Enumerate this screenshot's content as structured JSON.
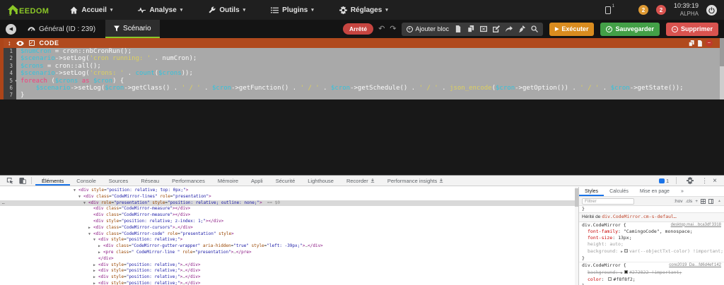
{
  "icons": {
    "caret": "▾",
    "play": "▶",
    "check": "✓",
    "minus": "–",
    "plus": "+",
    "undo": "↶",
    "redo": "↷",
    "back": "◀",
    "dots": "⋮",
    "close": "×",
    "up_arrow": "▲",
    "more": "»",
    "drag": "↕"
  },
  "topnav": {
    "brand_text": "EEDOM",
    "caret": "▾",
    "items": [
      {
        "label": "Accueil",
        "icon": "home-icon"
      },
      {
        "label": "Analyse",
        "icon": "pulse-icon"
      },
      {
        "label": "Outils",
        "icon": "wrench-icon"
      },
      {
        "label": "Plugins",
        "icon": "list-icon"
      },
      {
        "label": "Réglages",
        "icon": "gear-icon"
      }
    ],
    "mobile_indicator": "1",
    "warning_count": "2",
    "error_count": "2",
    "time": "10:39:19",
    "version": "ALPHA"
  },
  "subnav": {
    "general_tab": "Général (ID : 239)",
    "scenario_tab": "Scénario",
    "status_badge": "Arrêté",
    "add_block_label": "Ajouter bloc",
    "execute_label": "Exécuter",
    "save_label": "Sauvegarder",
    "delete_label": "Supprimer"
  },
  "code_block": {
    "title": "CODE",
    "fold_marker": "▾",
    "lines": [
      {
        "num": "1",
        "tokens": [
          [
            "v",
            "$numCron"
          ],
          [
            "p",
            " = cron::nbCronRun();"
          ]
        ]
      },
      {
        "num": "2",
        "tokens": [
          [
            "v",
            "$scenario"
          ],
          [
            "p",
            "->setLog("
          ],
          [
            "s",
            "'cron running: '"
          ],
          [
            "p",
            " . numCron);"
          ]
        ]
      },
      {
        "num": "3",
        "tokens": [
          [
            "v",
            "$crons"
          ],
          [
            "p",
            " = cron::all();"
          ]
        ]
      },
      {
        "num": "4",
        "tokens": [
          [
            "v",
            "$scenario"
          ],
          [
            "p",
            "->setLog("
          ],
          [
            "s",
            "'crons: '"
          ],
          [
            "p",
            " . "
          ],
          [
            "v",
            "count"
          ],
          [
            "p",
            "("
          ],
          [
            "v",
            "$crons"
          ],
          [
            "p",
            "));"
          ]
        ]
      },
      {
        "num": "5",
        "fold": true,
        "tokens": [
          [
            "k",
            "foreach"
          ],
          [
            "p",
            " ("
          ],
          [
            "v",
            "$crons"
          ],
          [
            "p",
            " "
          ],
          [
            "k",
            "as"
          ],
          [
            "p",
            " "
          ],
          [
            "v",
            "$cron"
          ],
          [
            "p",
            ") {"
          ]
        ]
      },
      {
        "num": "6",
        "tokens": [
          [
            "p",
            "    "
          ],
          [
            "v",
            "$scenario"
          ],
          [
            "p",
            "->setLog("
          ],
          [
            "v",
            "$cron"
          ],
          [
            "p",
            "->getClass() . "
          ],
          [
            "s",
            "' / '"
          ],
          [
            "p",
            " . "
          ],
          [
            "v",
            "$cron"
          ],
          [
            "p",
            "->getFunction() . "
          ],
          [
            "s",
            "' / '"
          ],
          [
            "p",
            " . "
          ],
          [
            "v",
            "$cron"
          ],
          [
            "p",
            "->getSchedule() . "
          ],
          [
            "s",
            "' / '"
          ],
          [
            "p",
            " . "
          ],
          [
            "s",
            "json_encode"
          ],
          [
            "p",
            "("
          ],
          [
            "v",
            "$cron"
          ],
          [
            "p",
            "->getOption()) . "
          ],
          [
            "s",
            "' / '"
          ],
          [
            "p",
            " . "
          ],
          [
            "v",
            "$cron"
          ],
          [
            "p",
            "->getState());"
          ]
        ]
      },
      {
        "num": "7",
        "tokens": [
          [
            "p",
            "}"
          ]
        ]
      }
    ]
  },
  "devtools": {
    "arrows": {
      "v": "▼",
      "r": "▶"
    },
    "tree_overflow": "…",
    "tabs": [
      {
        "label": "Éléments",
        "active": true
      },
      {
        "label": "Console"
      },
      {
        "label": "Sources"
      },
      {
        "label": "Réseau"
      },
      {
        "label": "Performances"
      },
      {
        "label": "Mémoire"
      },
      {
        "label": "Appli"
      },
      {
        "label": "Sécurité"
      },
      {
        "label": "Lighthouse"
      },
      {
        "label": "Recorder",
        "preview": true
      },
      {
        "label": "Performance insights",
        "preview": true
      }
    ],
    "issues_count": "1",
    "tree": [
      {
        "i": 0,
        "a": "v",
        "t": [
          [
            "pu",
            "<div "
          ],
          [
            "an",
            "style"
          ],
          [
            "dk",
            "="
          ],
          [
            "av",
            "\"position: relative; top: 0px;\""
          ],
          [
            "pu",
            ">"
          ]
        ]
      },
      {
        "i": 1,
        "a": "v",
        "t": [
          [
            "pu",
            "<div "
          ],
          [
            "an",
            "class"
          ],
          [
            "dk",
            "="
          ],
          [
            "av",
            "\"CodeMirror-lines\""
          ],
          [
            "dk",
            " "
          ],
          [
            "an",
            "role"
          ],
          [
            "dk",
            "="
          ],
          [
            "av",
            "\"presentation\""
          ],
          [
            "pu",
            ">"
          ]
        ]
      },
      {
        "i": 2,
        "a": "v",
        "sel": true,
        "t": [
          [
            "pu",
            "<div "
          ],
          [
            "an",
            "role"
          ],
          [
            "dk",
            "="
          ],
          [
            "av",
            "\"presentation\""
          ],
          [
            "dk",
            " "
          ],
          [
            "an",
            "style"
          ],
          [
            "dk",
            "="
          ],
          [
            "av",
            "\"position: relative; outline: none;\""
          ],
          [
            "pu",
            ">"
          ],
          [
            "gr",
            "  == $0"
          ]
        ]
      },
      {
        "i": 3,
        "t": [
          [
            "pu",
            "<div "
          ],
          [
            "an",
            "class"
          ],
          [
            "dk",
            "="
          ],
          [
            "av",
            "\"CodeMirror-measure\""
          ],
          [
            "pu",
            "></div>"
          ]
        ]
      },
      {
        "i": 3,
        "t": [
          [
            "pu",
            "<div "
          ],
          [
            "an",
            "class"
          ],
          [
            "dk",
            "="
          ],
          [
            "av",
            "\"CodeMirror-measure\""
          ],
          [
            "pu",
            "></div>"
          ]
        ]
      },
      {
        "i": 3,
        "t": [
          [
            "pu",
            "<div "
          ],
          [
            "an",
            "style"
          ],
          [
            "dk",
            "="
          ],
          [
            "av",
            "\"position: relative; z-index: 1;\""
          ],
          [
            "pu",
            "></div>"
          ]
        ]
      },
      {
        "i": 3,
        "a": "r",
        "t": [
          [
            "pu",
            "<div "
          ],
          [
            "an",
            "class"
          ],
          [
            "dk",
            "="
          ],
          [
            "av",
            "\"CodeMirror-cursors\""
          ],
          [
            "pu",
            ">"
          ],
          [
            "gr",
            "…"
          ],
          [
            "pu",
            "</div>"
          ]
        ]
      },
      {
        "i": 3,
        "a": "v",
        "t": [
          [
            "pu",
            "<div "
          ],
          [
            "an",
            "class"
          ],
          [
            "dk",
            "="
          ],
          [
            "av",
            "\"CodeMirror-code\""
          ],
          [
            "dk",
            " "
          ],
          [
            "an",
            "role"
          ],
          [
            "dk",
            "="
          ],
          [
            "av",
            "\"presentation\""
          ],
          [
            "dk",
            " "
          ],
          [
            "an",
            "style"
          ],
          [
            "pu",
            ">"
          ]
        ]
      },
      {
        "i": 4,
        "a": "v",
        "t": [
          [
            "pu",
            "<div "
          ],
          [
            "an",
            "style"
          ],
          [
            "dk",
            "="
          ],
          [
            "av",
            "\"position: relative;\""
          ],
          [
            "pu",
            ">"
          ]
        ]
      },
      {
        "i": 5,
        "a": "r",
        "t": [
          [
            "pu",
            "<div "
          ],
          [
            "an",
            "class"
          ],
          [
            "dk",
            "="
          ],
          [
            "av",
            "\"CodeMirror-gutter-wrapper\""
          ],
          [
            "dk",
            " "
          ],
          [
            "an",
            "aria-hidden"
          ],
          [
            "dk",
            "="
          ],
          [
            "av",
            "\"true\""
          ],
          [
            "dk",
            " "
          ],
          [
            "an",
            "style"
          ],
          [
            "dk",
            "="
          ],
          [
            "av",
            "\"left: -39px;\""
          ],
          [
            "pu",
            ">"
          ],
          [
            "gr",
            "…"
          ],
          [
            "pu",
            "</div>"
          ]
        ]
      },
      {
        "i": 5,
        "a": "r",
        "t": [
          [
            "pu",
            "<pre "
          ],
          [
            "an",
            "class"
          ],
          [
            "dk",
            "="
          ],
          [
            "av",
            "\" CodeMirror-line \""
          ],
          [
            "dk",
            " "
          ],
          [
            "an",
            "role"
          ],
          [
            "dk",
            "="
          ],
          [
            "av",
            "\"presentation\""
          ],
          [
            "pu",
            ">"
          ],
          [
            "gr",
            "…"
          ],
          [
            "pu",
            "</pre>"
          ]
        ]
      },
      {
        "i": 4,
        "t": [
          [
            "pu",
            "</div>"
          ]
        ]
      },
      {
        "i": 4,
        "a": "r",
        "t": [
          [
            "pu",
            "<div "
          ],
          [
            "an",
            "style"
          ],
          [
            "dk",
            "="
          ],
          [
            "av",
            "\"position: relative;\""
          ],
          [
            "pu",
            ">"
          ],
          [
            "gr",
            "…"
          ],
          [
            "pu",
            "</div>"
          ]
        ]
      },
      {
        "i": 4,
        "a": "r",
        "t": [
          [
            "pu",
            "<div "
          ],
          [
            "an",
            "style"
          ],
          [
            "dk",
            "="
          ],
          [
            "av",
            "\"position: relative;\""
          ],
          [
            "pu",
            ">"
          ],
          [
            "gr",
            "…"
          ],
          [
            "pu",
            "</div>"
          ]
        ]
      },
      {
        "i": 4,
        "a": "r",
        "t": [
          [
            "pu",
            "<div "
          ],
          [
            "an",
            "style"
          ],
          [
            "dk",
            "="
          ],
          [
            "av",
            "\"position: relative;\""
          ],
          [
            "pu",
            ">"
          ],
          [
            "gr",
            "…"
          ],
          [
            "pu",
            "</div>"
          ]
        ]
      },
      {
        "i": 4,
        "a": "r",
        "t": [
          [
            "pu",
            "<div "
          ],
          [
            "an",
            "style"
          ],
          [
            "dk",
            "="
          ],
          [
            "av",
            "\"position: relative;\""
          ],
          [
            "pu",
            ">"
          ],
          [
            "gr",
            "…"
          ],
          [
            "pu",
            "</div>"
          ]
        ]
      }
    ],
    "styles_pane": {
      "tabs": [
        {
          "label": "Styles",
          "active": true
        },
        {
          "label": "Calculés"
        },
        {
          "label": "Mise en page"
        },
        {
          "label": "»"
        }
      ],
      "filter_placeholder": "Filtrer",
      "toolbar_labels": [
        ":hov",
        ".cls",
        "+"
      ],
      "rows": [
        {
          "type": "close",
          "text": "}"
        },
        {
          "type": "inherited",
          "prefix": "Hérité de ",
          "selector": "div.CodeMirror.cm-s-defaul…"
        },
        {
          "type": "selector",
          "selector": "div.CodeMirror {",
          "link": "desktop.mai…bca3df:3318"
        },
        {
          "type": "prop",
          "name": "font-family",
          "value": "\"CamingoCode\", monospace;"
        },
        {
          "type": "prop",
          "name": "font-size",
          "value": "13px;"
        },
        {
          "type": "prop",
          "name": "height",
          "value": "auto;",
          "muted": true
        },
        {
          "type": "prop",
          "name": "background",
          "value": "var(--objectTxt-color) !important;",
          "muted": true,
          "arrow": true,
          "swatch": "checker"
        },
        {
          "type": "close",
          "text": "}"
        },
        {
          "type": "selector",
          "selector": "div.CodeMirror {",
          "link": "core2019_Da…fd6d4ef:142",
          "sep": true
        },
        {
          "type": "prop",
          "name": "background",
          "value": "#272822 !important;",
          "struck": true,
          "arrow": true,
          "swatch": "#272822"
        },
        {
          "type": "prop",
          "name": "color",
          "value": "#f8f8f2;",
          "swatch": "#f8f8f2"
        },
        {
          "type": "close",
          "text": "}"
        }
      ]
    }
  },
  "colors": {
    "accent_green": "#8bc727",
    "code_header_orange": "#b04a1e",
    "execute_orange": "#d98c1f",
    "save_green": "#43a047",
    "danger_red": "#d9534f",
    "devtools_blue": "#1a73e8",
    "monokai_bg": "#272822",
    "monokai_fg": "#f8f8f2"
  }
}
